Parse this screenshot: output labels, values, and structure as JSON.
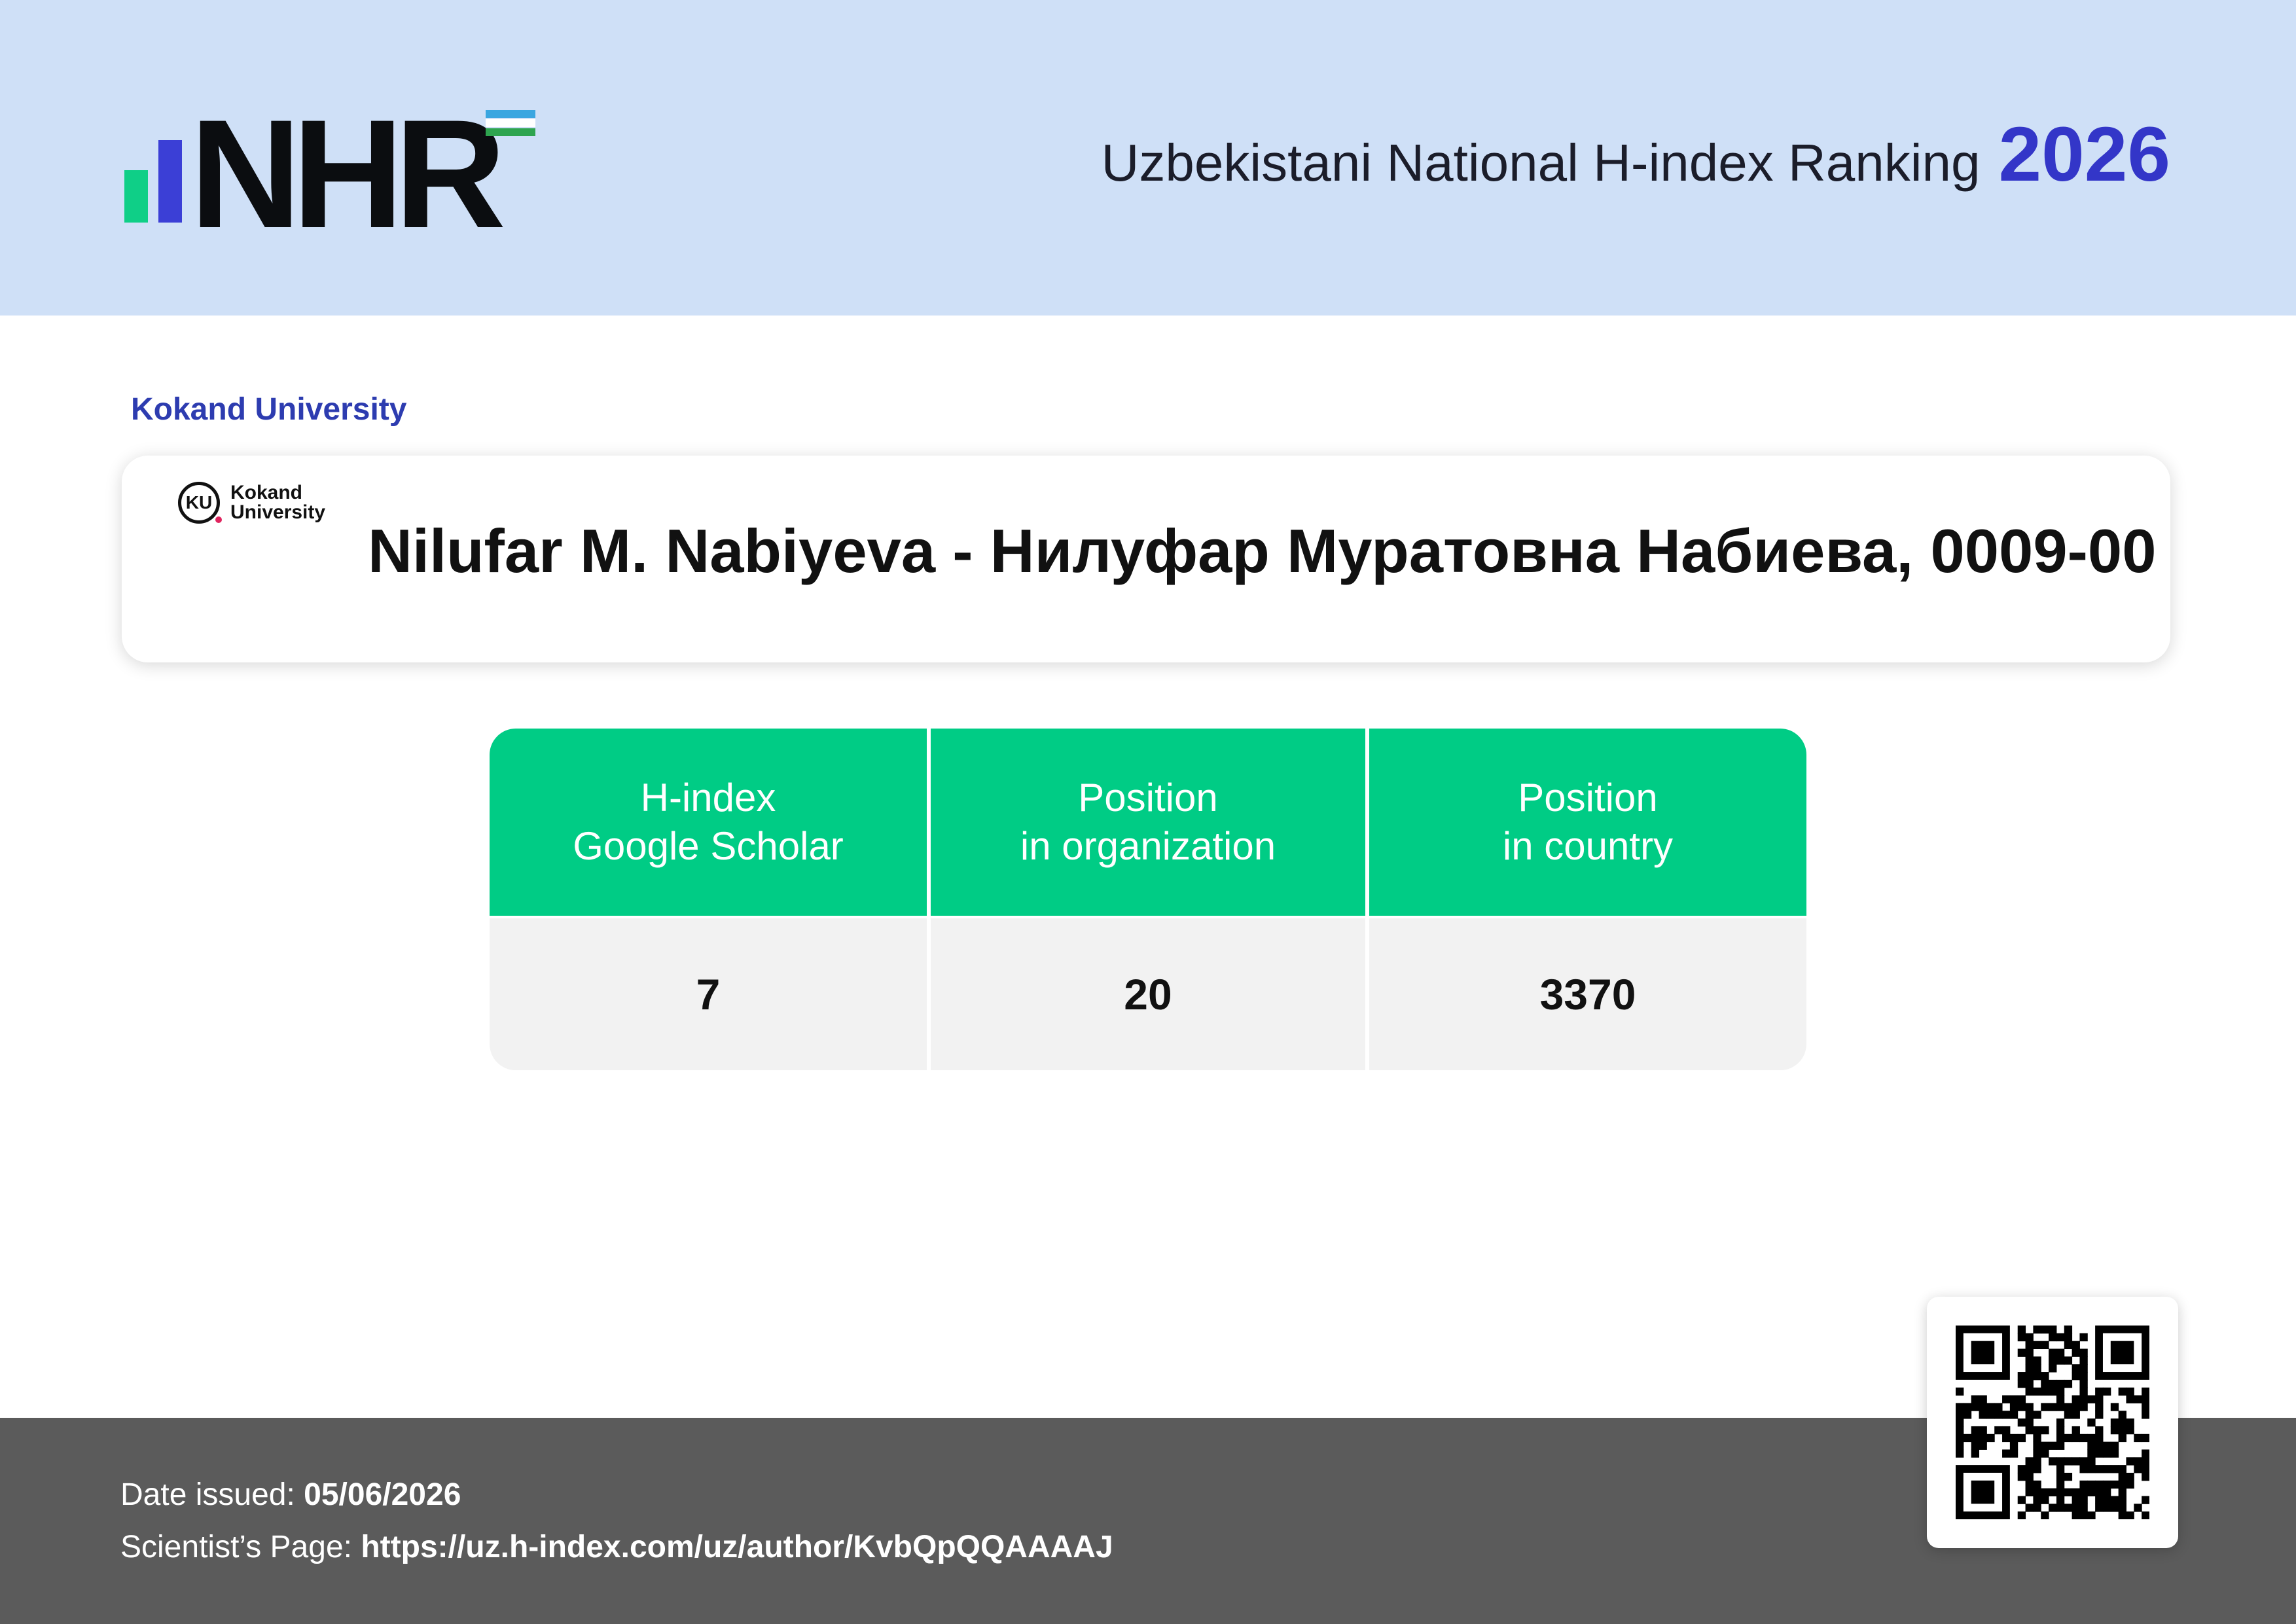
{
  "header": {
    "logo_text": "NHR",
    "title": "Uzbekistani National H-index Ranking",
    "year": "2026",
    "colors": {
      "background": "#cfe0f7",
      "accent": "#3336c8",
      "bar_green": "#0fcf87",
      "bar_blue": "#3b3fd6"
    }
  },
  "organization": {
    "label": "Kokand University",
    "logo_initials": "KU",
    "logo_text_line1": "Kokand",
    "logo_text_line2": "University"
  },
  "scientist": {
    "name": "Nilufar M. Nabiyeva - Нилуфар Муратовна Набиева, 0009-00"
  },
  "stats": {
    "header_color": "#00cc85",
    "columns": [
      {
        "line1": "H-index",
        "line2": "Google Scholar",
        "value": "7"
      },
      {
        "line1": "Position",
        "line2": "in organization",
        "value": "20"
      },
      {
        "line1": "Position",
        "line2": "in country",
        "value": "3370"
      }
    ]
  },
  "footer": {
    "date_label": "Date issued:",
    "date_value": "05/06/2026",
    "page_label": "Scientist’s Page:",
    "page_value": "https://uz.h-index.com/uz/author/KvbQpQQAAAAJ",
    "background": "#5b5b5b"
  },
  "qr": {
    "icon": "qr-code-icon"
  }
}
